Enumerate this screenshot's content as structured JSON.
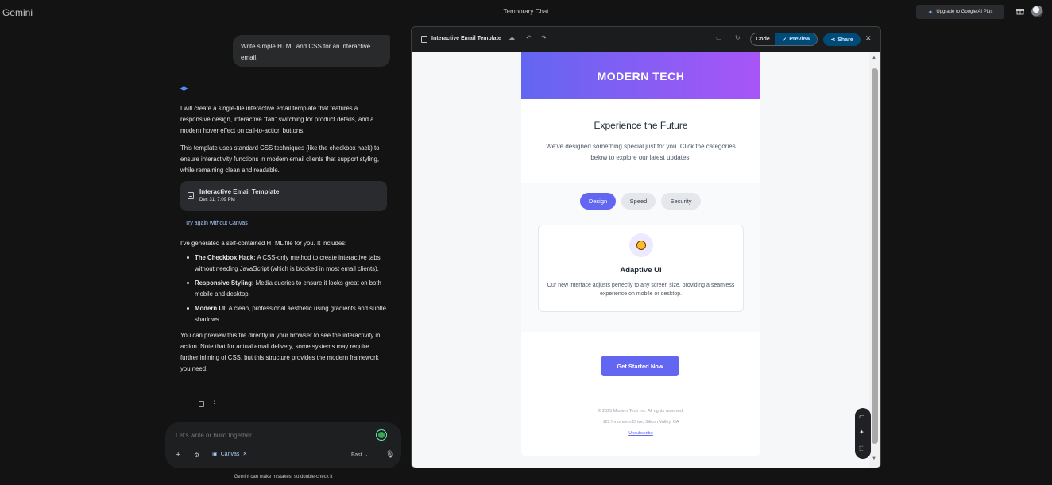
{
  "app": {
    "brand": "Gemini",
    "chat_mode": "Temporary Chat",
    "upgrade_label": "Upgrade to Google AI Plus"
  },
  "user_message": "Write simple HTML and CSS for an interactive email.",
  "reply": {
    "p1": "I will create a single-file interactive email template that features a responsive design, interactive \"tab\" switching for product details, and a modern hover effect on call-to-action buttons.",
    "p2": "This template uses standard CSS techniques (like the checkbox hack) to ensure interactivity functions in modern email clients that support styling, while remaining clean and readable.",
    "artifact_title": "Interactive Email Template",
    "artifact_date": "Dec 31, 7:09 PM",
    "try_again": "Try again without Canvas",
    "p3": "I've generated a self-contained HTML file for you. It includes:",
    "bullets": [
      {
        "bold": "The Checkbox Hack:",
        "text": " A CSS-only method to create interactive tabs without needing JavaScript (which is blocked in most email clients)."
      },
      {
        "bold": "Responsive Styling:",
        "text": " Media queries to ensure it looks great on both mobile and desktop."
      },
      {
        "bold": "Modern UI:",
        "text": " A clean, professional aesthetic using gradients and subtle shadows."
      }
    ],
    "p4": "You can preview this file directly in your browser to see the interactivity in action. Note that for actual email delivery, some systems may require further inlining of CSS, but this structure provides the modern framework you need."
  },
  "input": {
    "placeholder": "Let's write or build together",
    "canvas_chip": "Canvas",
    "model": "Fast"
  },
  "disclaimer": "Gemini can make mistakes, so double-check it",
  "panel": {
    "title": "Interactive Email Template",
    "code_tab": "Code",
    "preview_tab": "Preview",
    "share": "Share"
  },
  "email": {
    "brand": "MODERN TECH",
    "heading": "Experience the Future",
    "intro": "We've designed something special just for you. Click the categories below to explore our latest updates.",
    "tabs": [
      "Design",
      "Speed",
      "Security"
    ],
    "feature_title": "Adaptive UI",
    "feature_desc": "Our new interface adjusts perfectly to any screen size, providing a seamless experience on mobile or desktop.",
    "cta": "Get Started Now",
    "footer_copyright": "© 2025 Modern Tech Inc. All rights reserved.",
    "footer_address": "123 Innovation Drive, Silicon Valley, CA",
    "footer_unsubscribe": "Unsubscribe"
  },
  "colors": {
    "accent": "#6366f1",
    "gradient_end": "#a855f7",
    "link": "#a8c7fa",
    "bg": "#131314"
  }
}
